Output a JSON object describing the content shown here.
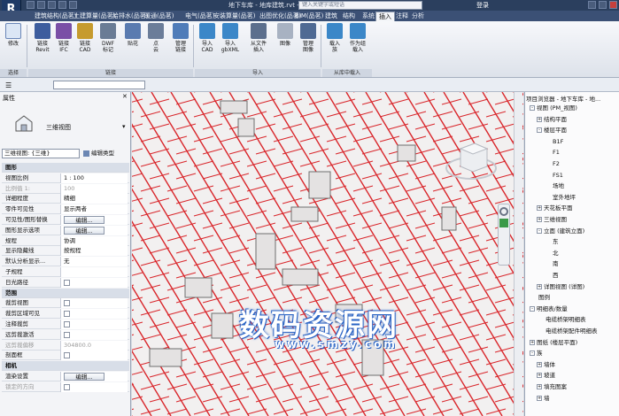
{
  "window": {
    "title": "地下车库 - 地库建筑.rvt - 三维视图: {三维}",
    "search_placeholder": "键入关键字或短语",
    "login": "登录"
  },
  "ribbon_tabs": [
    "建筑结构(品茗)",
    "土建算量(品茗)",
    "给排水(品茗)",
    "暖通(品茗)",
    "电气(品茗)",
    "安装算量(品茗)",
    "出图优化(品茗)",
    "BIM(品茗)",
    "建筑",
    "结构",
    "系统",
    "插入",
    "注释",
    "分析"
  ],
  "active_tab": "插入",
  "ribbon": {
    "modify": "修改",
    "select_group": "选择",
    "link_group": "链接",
    "import_group": "导入",
    "library_group": "从库中载入",
    "buttons": [
      {
        "label": "链接\nRevit",
        "icon": "link-revit-icon",
        "color": "#3d5d9e"
      },
      {
        "label": "链接\nIFC",
        "icon": "link-ifc-icon",
        "color": "#7a4fa6"
      },
      {
        "label": "链接\nCAD",
        "icon": "link-cad-icon",
        "color": "#c69b2e"
      },
      {
        "label": "DWF\n标记",
        "icon": "dwf-markup-icon",
        "color": "#6a7c95"
      },
      {
        "label": "贴花",
        "icon": "decal-icon",
        "color": "#5a7bb0"
      },
      {
        "label": "点\n云",
        "icon": "point-cloud-icon",
        "color": "#6b7d99"
      },
      {
        "label": "管理\n链接",
        "icon": "manage-links-icon",
        "color": "#4f7cb9"
      },
      {
        "label": "导入\nCAD",
        "icon": "import-cad-icon",
        "color": "#3b87c8"
      },
      {
        "label": "导入\ngbXML",
        "icon": "import-gbxml-icon",
        "color": "#3b87c8"
      },
      {
        "label": "从文件\n插入",
        "icon": "insert-from-file-icon",
        "color": "#5c6f8d"
      },
      {
        "label": "图像",
        "icon": "image-icon",
        "color": "#a8b2c2"
      },
      {
        "label": "管理\n图像",
        "icon": "manage-images-icon",
        "color": "#4f6a93"
      },
      {
        "label": "载入\n族",
        "icon": "load-family-icon",
        "color": "#3b87c8"
      },
      {
        "label": "作为组\n载入",
        "icon": "load-as-group-icon",
        "color": "#3b87c8"
      }
    ]
  },
  "properties": {
    "title": "属性",
    "type_name": "三维视图",
    "selector": "三维视图: {三维}",
    "edit_type": "编辑类型",
    "rows": [
      {
        "k": "图形",
        "v": "",
        "kind": "section"
      },
      {
        "k": "视图比例",
        "v": "1 : 100",
        "kind": "field"
      },
      {
        "k": "比例值 1:",
        "v": "100",
        "kind": "grey"
      },
      {
        "k": "详细程度",
        "v": "精细",
        "kind": "field"
      },
      {
        "k": "零件可见性",
        "v": "显示两者",
        "kind": "field"
      },
      {
        "k": "可见性/图形替换",
        "v": "编辑...",
        "kind": "button"
      },
      {
        "k": "图形显示选项",
        "v": "编辑...",
        "kind": "button"
      },
      {
        "k": "规程",
        "v": "协调",
        "kind": "field"
      },
      {
        "k": "显示隐藏线",
        "v": "按规程",
        "kind": "field"
      },
      {
        "k": "默认分析显示...",
        "v": "无",
        "kind": "field"
      },
      {
        "k": "子规程",
        "v": "",
        "kind": "field"
      },
      {
        "k": "日光路径",
        "v": "",
        "kind": "check"
      },
      {
        "k": "范围",
        "v": "",
        "kind": "section"
      },
      {
        "k": "裁剪视图",
        "v": "",
        "kind": "check"
      },
      {
        "k": "裁剪区域可见",
        "v": "",
        "kind": "check"
      },
      {
        "k": "注释裁剪",
        "v": "",
        "kind": "check"
      },
      {
        "k": "远剪裁激活",
        "v": "",
        "kind": "check"
      },
      {
        "k": "远剪裁偏移",
        "v": "304800.0",
        "kind": "grey"
      },
      {
        "k": "剖面框",
        "v": "",
        "kind": "check"
      },
      {
        "k": "相机",
        "v": "",
        "kind": "section"
      },
      {
        "k": "渲染设置",
        "v": "编辑...",
        "kind": "button"
      },
      {
        "k": "锁定的方向",
        "v": "",
        "kind": "check-grey"
      }
    ]
  },
  "browser": {
    "title": "项目浏览器 - 地下车库 - 地...",
    "nodes": [
      {
        "label": "视图 (PM_视图)",
        "level": 0,
        "tog": "-"
      },
      {
        "label": "结构平面",
        "level": 1,
        "tog": "+"
      },
      {
        "label": "楼层平面",
        "level": 1,
        "tog": "-"
      },
      {
        "label": "B1F",
        "level": 2,
        "tog": ""
      },
      {
        "label": "F1",
        "level": 2,
        "tog": ""
      },
      {
        "label": "F2",
        "level": 2,
        "tog": ""
      },
      {
        "label": "FS1",
        "level": 2,
        "tog": ""
      },
      {
        "label": "场地",
        "level": 2,
        "tog": ""
      },
      {
        "label": "室外地坪",
        "level": 2,
        "tog": ""
      },
      {
        "label": "天花板平面",
        "level": 1,
        "tog": "+"
      },
      {
        "label": "三维视图",
        "level": 1,
        "tog": "+"
      },
      {
        "label": "立面 (建筑立面)",
        "level": 1,
        "tog": "-"
      },
      {
        "label": "东",
        "level": 2,
        "tog": ""
      },
      {
        "label": "北",
        "level": 2,
        "tog": ""
      },
      {
        "label": "南",
        "level": 2,
        "tog": ""
      },
      {
        "label": "西",
        "level": 2,
        "tog": ""
      },
      {
        "label": "详图视图 (详图)",
        "level": 1,
        "tog": "+"
      },
      {
        "label": "图例",
        "level": 0,
        "tog": ""
      },
      {
        "label": "明细表/数量",
        "level": 0,
        "tog": "-"
      },
      {
        "label": "电缆桥架明细表",
        "level": 1,
        "tog": ""
      },
      {
        "label": "电缆桥架配件明细表",
        "level": 1,
        "tog": ""
      },
      {
        "label": "图纸 (楼层平面)",
        "level": 0,
        "tog": "+"
      },
      {
        "label": "族",
        "level": 0,
        "tog": "-"
      },
      {
        "label": "墙体",
        "level": 1,
        "tog": "+"
      },
      {
        "label": "坡道",
        "level": 1,
        "tog": "+"
      },
      {
        "label": "填充图案",
        "level": 1,
        "tog": "+"
      },
      {
        "label": "墙",
        "level": 1,
        "tog": "+"
      }
    ]
  },
  "watermark": {
    "brand": "数码资源网",
    "url": "www.smzy.com"
  },
  "colors": {
    "accent": "#3b5075",
    "pipe": "#d9262b"
  }
}
